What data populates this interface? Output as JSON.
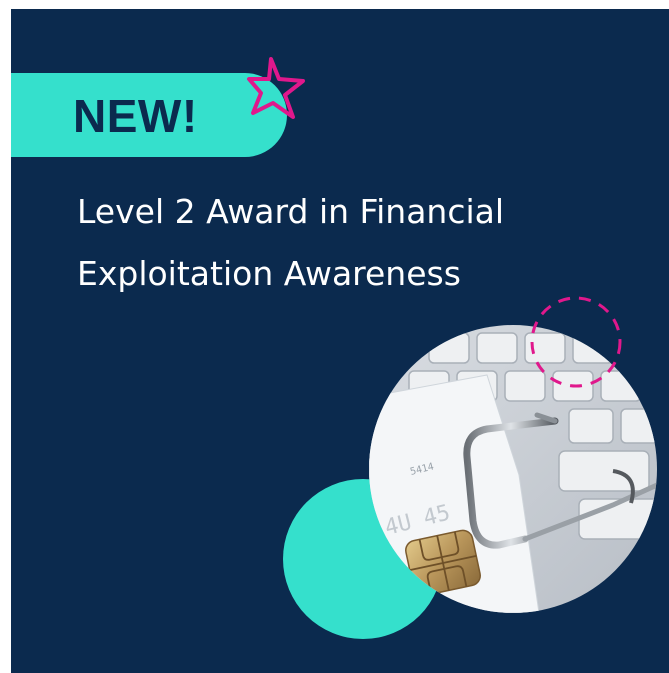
{
  "badge": {
    "text": "NEW!"
  },
  "title": {
    "line1": "Level 2 Award in Financial",
    "line2": "Exploitation Awareness"
  },
  "photo": {
    "card_digits": "4U 45",
    "card_small": "5414"
  },
  "colors": {
    "background": "#0b2a4e",
    "accent_teal": "#35e0cc",
    "accent_magenta": "#e0188c",
    "text": "#ffffff"
  },
  "icons": [
    "star-icon",
    "fishing-hook-icon",
    "credit-card-chip-icon"
  ]
}
